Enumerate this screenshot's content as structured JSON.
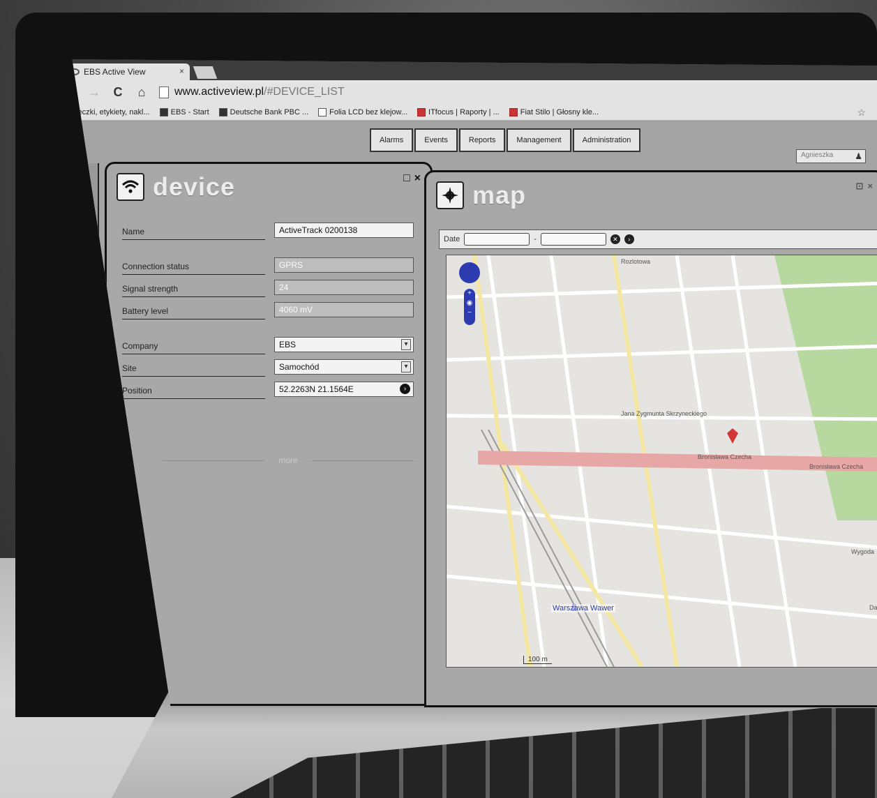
{
  "browser": {
    "tab_title": "EBS Active View",
    "tab_close": "×",
    "url_base": "www.activeview.pl",
    "url_hash": "/#DEVICE_LIST",
    "nav": {
      "back": "←",
      "forward": "→",
      "reload": "C",
      "home": "⌂"
    },
    "bookmarks": [
      {
        "label": "Teczki, etykiety, nakl..."
      },
      {
        "label": "EBS - Start"
      },
      {
        "label": "Deutsche Bank PBC ..."
      },
      {
        "label": "Folia LCD bez klejow..."
      },
      {
        "label": "ITfocus | Raporty | ..."
      },
      {
        "label": "Fiat Stilo | Głosny kle..."
      }
    ]
  },
  "app": {
    "menu": [
      "Alarms",
      "Events",
      "Reports",
      "Management",
      "Administration"
    ],
    "user": "Agnieszka",
    "left_close": "×"
  },
  "device_panel": {
    "title": "device",
    "controls": [
      "□",
      "×"
    ],
    "fields": {
      "name": {
        "label": "Name",
        "value": "ActiveTrack 0200138"
      },
      "connection_status": {
        "label": "Connection status",
        "value": "GPRS"
      },
      "signal_strength": {
        "label": "Signal strength",
        "value": "24"
      },
      "battery_level": {
        "label": "Battery level",
        "value": "4060 mV"
      },
      "company": {
        "label": "Company",
        "value": "EBS"
      },
      "site": {
        "label": "Site",
        "value": "Samochód"
      },
      "position": {
        "label": "Position",
        "value": "52.2263N 21.1564E"
      }
    },
    "more_label": "more"
  },
  "map_panel": {
    "title": "map",
    "controls": [
      "⊡",
      "×"
    ],
    "date_label": "Date",
    "date_separator": "-",
    "date_from": "",
    "date_to": "",
    "streets": {
      "s1": "Jana Zygmunta Skrzyneckiego",
      "s2": "Bronisława Czecha",
      "s3": "Bronisława Czecha",
      "s4": "Rozlotowa",
      "s5": "Wygoda",
      "s6": "Data"
    },
    "station": "Warszawa Wawer",
    "scale": "100 m"
  }
}
